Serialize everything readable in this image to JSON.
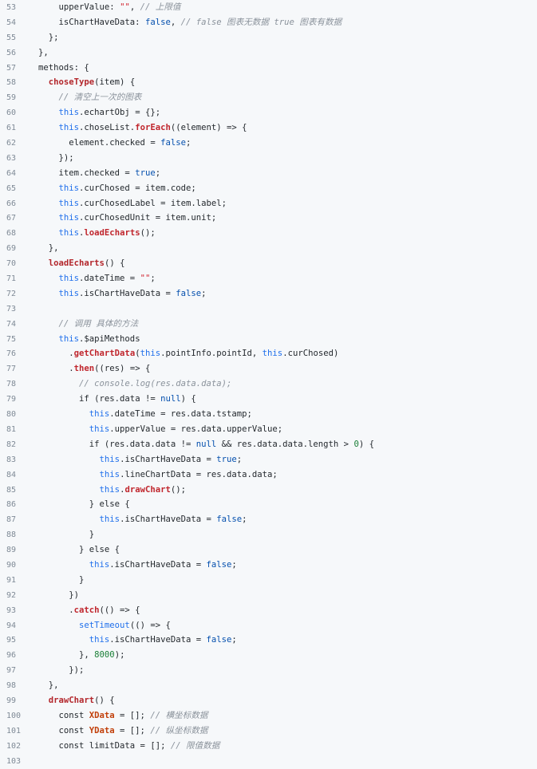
{
  "code": {
    "lines": [
      {
        "n": "53",
        "tokens": [
          [
            "plain",
            "    upperValue: "
          ],
          [
            "str",
            "\"\""
          ],
          [
            "plain",
            ", "
          ],
          [
            "cm",
            "// 上限值"
          ]
        ]
      },
      {
        "n": "54",
        "tokens": [
          [
            "plain",
            "    isChartHaveData: "
          ],
          [
            "bool",
            "false"
          ],
          [
            "plain",
            ", "
          ],
          [
            "cm",
            "// false 图表无数据 true 图表有数据"
          ]
        ]
      },
      {
        "n": "55",
        "tokens": [
          [
            "plain",
            "  };"
          ]
        ]
      },
      {
        "n": "56",
        "tokens": [
          [
            "plain",
            "},"
          ]
        ]
      },
      {
        "n": "57",
        "tokens": [
          [
            "plain",
            "methods: {"
          ]
        ]
      },
      {
        "n": "58",
        "tokens": [
          [
            "plain",
            "  "
          ],
          [
            "fn",
            "choseType"
          ],
          [
            "plain",
            "(item) {"
          ]
        ]
      },
      {
        "n": "59",
        "tokens": [
          [
            "plain",
            "    "
          ],
          [
            "cm",
            "// 清空上一次的图表"
          ]
        ]
      },
      {
        "n": "60",
        "tokens": [
          [
            "plain",
            "    "
          ],
          [
            "kw",
            "this"
          ],
          [
            "plain",
            ".echartObj = {};"
          ]
        ]
      },
      {
        "n": "61",
        "tokens": [
          [
            "plain",
            "    "
          ],
          [
            "kw",
            "this"
          ],
          [
            "plain",
            ".choseList."
          ],
          [
            "mfn",
            "forEach"
          ],
          [
            "plain",
            "((element) => {"
          ]
        ]
      },
      {
        "n": "62",
        "tokens": [
          [
            "plain",
            "      element.checked = "
          ],
          [
            "bool",
            "false"
          ],
          [
            "plain",
            ";"
          ]
        ]
      },
      {
        "n": "63",
        "tokens": [
          [
            "plain",
            "    });"
          ]
        ]
      },
      {
        "n": "64",
        "tokens": [
          [
            "plain",
            "    item.checked = "
          ],
          [
            "bool",
            "true"
          ],
          [
            "plain",
            ";"
          ]
        ]
      },
      {
        "n": "65",
        "tokens": [
          [
            "plain",
            "    "
          ],
          [
            "kw",
            "this"
          ],
          [
            "plain",
            ".curChosed = item.code;"
          ]
        ]
      },
      {
        "n": "66",
        "tokens": [
          [
            "plain",
            "    "
          ],
          [
            "kw",
            "this"
          ],
          [
            "plain",
            ".curChosedLabel = item.label;"
          ]
        ]
      },
      {
        "n": "67",
        "tokens": [
          [
            "plain",
            "    "
          ],
          [
            "kw",
            "this"
          ],
          [
            "plain",
            ".curChosedUnit = item.unit;"
          ]
        ]
      },
      {
        "n": "68",
        "tokens": [
          [
            "plain",
            "    "
          ],
          [
            "kw",
            "this"
          ],
          [
            "plain",
            "."
          ],
          [
            "mfn",
            "loadEcharts"
          ],
          [
            "plain",
            "();"
          ]
        ]
      },
      {
        "n": "69",
        "tokens": [
          [
            "plain",
            "  },"
          ]
        ]
      },
      {
        "n": "70",
        "tokens": [
          [
            "plain",
            "  "
          ],
          [
            "fn",
            "loadEcharts"
          ],
          [
            "plain",
            "() {"
          ]
        ]
      },
      {
        "n": "71",
        "tokens": [
          [
            "plain",
            "    "
          ],
          [
            "kw",
            "this"
          ],
          [
            "plain",
            ".dateTime = "
          ],
          [
            "str",
            "\"\""
          ],
          [
            "plain",
            ";"
          ]
        ]
      },
      {
        "n": "72",
        "tokens": [
          [
            "plain",
            "    "
          ],
          [
            "kw",
            "this"
          ],
          [
            "plain",
            ".isChartHaveData = "
          ],
          [
            "bool",
            "false"
          ],
          [
            "plain",
            ";"
          ]
        ]
      },
      {
        "n": "73",
        "tokens": []
      },
      {
        "n": "74",
        "tokens": [
          [
            "plain",
            "    "
          ],
          [
            "cm",
            "// 调用 具体的方法"
          ]
        ]
      },
      {
        "n": "75",
        "tokens": [
          [
            "plain",
            "    "
          ],
          [
            "kw",
            "this"
          ],
          [
            "plain",
            ".$apiMethods"
          ]
        ]
      },
      {
        "n": "76",
        "tokens": [
          [
            "plain",
            "      ."
          ],
          [
            "mfn",
            "getChartData"
          ],
          [
            "plain",
            "("
          ],
          [
            "kw",
            "this"
          ],
          [
            "plain",
            ".pointInfo.pointId, "
          ],
          [
            "kw",
            "this"
          ],
          [
            "plain",
            ".curChosed)"
          ]
        ]
      },
      {
        "n": "77",
        "tokens": [
          [
            "plain",
            "      ."
          ],
          [
            "mfn",
            "then"
          ],
          [
            "plain",
            "((res) => {"
          ]
        ]
      },
      {
        "n": "78",
        "tokens": [
          [
            "plain",
            "        "
          ],
          [
            "cm",
            "// console.log(res.data.data);"
          ]
        ]
      },
      {
        "n": "79",
        "tokens": [
          [
            "plain",
            "        "
          ],
          [
            "plain",
            "if (res.data != "
          ],
          [
            "bool",
            "null"
          ],
          [
            "plain",
            ") {"
          ]
        ]
      },
      {
        "n": "80",
        "tokens": [
          [
            "plain",
            "          "
          ],
          [
            "kw",
            "this"
          ],
          [
            "plain",
            ".dateTime = res.data.tstamp;"
          ]
        ]
      },
      {
        "n": "81",
        "tokens": [
          [
            "plain",
            "          "
          ],
          [
            "kw",
            "this"
          ],
          [
            "plain",
            ".upperValue = res.data.upperValue;"
          ]
        ]
      },
      {
        "n": "82",
        "tokens": [
          [
            "plain",
            "          if (res.data.data != "
          ],
          [
            "bool",
            "null"
          ],
          [
            "plain",
            " && res.data.data.length > "
          ],
          [
            "num",
            "0"
          ],
          [
            "plain",
            ") {"
          ]
        ]
      },
      {
        "n": "83",
        "tokens": [
          [
            "plain",
            "            "
          ],
          [
            "kw",
            "this"
          ],
          [
            "plain",
            ".isChartHaveData = "
          ],
          [
            "bool",
            "true"
          ],
          [
            "plain",
            ";"
          ]
        ]
      },
      {
        "n": "84",
        "tokens": [
          [
            "plain",
            "            "
          ],
          [
            "kw",
            "this"
          ],
          [
            "plain",
            ".lineChartData = res.data.data;"
          ]
        ]
      },
      {
        "n": "85",
        "tokens": [
          [
            "plain",
            "            "
          ],
          [
            "kw",
            "this"
          ],
          [
            "plain",
            "."
          ],
          [
            "mfn",
            "drawChart"
          ],
          [
            "plain",
            "();"
          ]
        ]
      },
      {
        "n": "86",
        "tokens": [
          [
            "plain",
            "          } else {"
          ]
        ]
      },
      {
        "n": "87",
        "tokens": [
          [
            "plain",
            "            "
          ],
          [
            "kw",
            "this"
          ],
          [
            "plain",
            ".isChartHaveData = "
          ],
          [
            "bool",
            "false"
          ],
          [
            "plain",
            ";"
          ]
        ]
      },
      {
        "n": "88",
        "tokens": [
          [
            "plain",
            "          }"
          ]
        ]
      },
      {
        "n": "89",
        "tokens": [
          [
            "plain",
            "        } else {"
          ]
        ]
      },
      {
        "n": "90",
        "tokens": [
          [
            "plain",
            "          "
          ],
          [
            "kw",
            "this"
          ],
          [
            "plain",
            ".isChartHaveData = "
          ],
          [
            "bool",
            "false"
          ],
          [
            "plain",
            ";"
          ]
        ]
      },
      {
        "n": "91",
        "tokens": [
          [
            "plain",
            "        }"
          ]
        ]
      },
      {
        "n": "92",
        "tokens": [
          [
            "plain",
            "      })"
          ]
        ]
      },
      {
        "n": "93",
        "tokens": [
          [
            "plain",
            "      ."
          ],
          [
            "mfn",
            "catch"
          ],
          [
            "plain",
            "(() => {"
          ]
        ]
      },
      {
        "n": "94",
        "tokens": [
          [
            "plain",
            "        "
          ],
          [
            "kw",
            "setTimeout"
          ],
          [
            "plain",
            "(() => {"
          ]
        ]
      },
      {
        "n": "95",
        "tokens": [
          [
            "plain",
            "          "
          ],
          [
            "kw",
            "this"
          ],
          [
            "plain",
            ".isChartHaveData = "
          ],
          [
            "bool",
            "false"
          ],
          [
            "plain",
            ";"
          ]
        ]
      },
      {
        "n": "96",
        "tokens": [
          [
            "plain",
            "        }, "
          ],
          [
            "num",
            "8000"
          ],
          [
            "plain",
            ");"
          ]
        ]
      },
      {
        "n": "97",
        "tokens": [
          [
            "plain",
            "      });"
          ]
        ]
      },
      {
        "n": "98",
        "tokens": [
          [
            "plain",
            "  },"
          ]
        ]
      },
      {
        "n": "99",
        "tokens": [
          [
            "plain",
            "  "
          ],
          [
            "fn",
            "drawChart"
          ],
          [
            "plain",
            "() {"
          ]
        ]
      },
      {
        "n": "100",
        "tokens": [
          [
            "plain",
            "    const "
          ],
          [
            "var",
            "XData"
          ],
          [
            "plain",
            " = []; "
          ],
          [
            "cm",
            "// 横坐标数据"
          ]
        ]
      },
      {
        "n": "101",
        "tokens": [
          [
            "plain",
            "    const "
          ],
          [
            "var",
            "YData"
          ],
          [
            "plain",
            " = []; "
          ],
          [
            "cm",
            "// 纵坐标数据"
          ]
        ]
      },
      {
        "n": "102",
        "tokens": [
          [
            "plain",
            "    const limitData = []; "
          ],
          [
            "cm",
            "// 限值数据"
          ]
        ]
      },
      {
        "n": "103",
        "tokens": []
      }
    ]
  }
}
